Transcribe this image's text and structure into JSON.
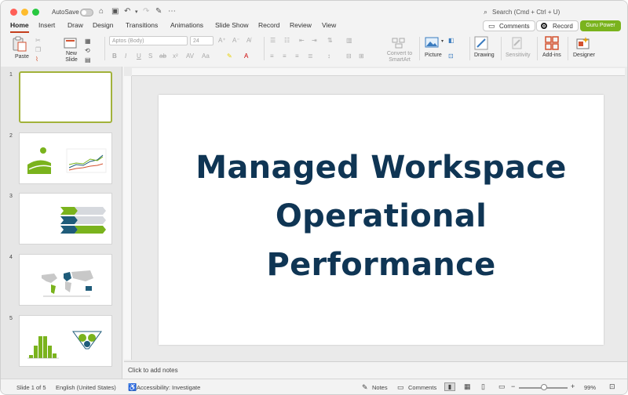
{
  "titlebar": {
    "autosave_label": "AutoSave",
    "search_placeholder": "Search (Cmd + Ctrl + U)"
  },
  "tabs": [
    "Home",
    "Insert",
    "Draw",
    "Design",
    "Transitions",
    "Animations",
    "Slide Show",
    "Record",
    "Review",
    "View"
  ],
  "header_buttons": {
    "comments": "Comments",
    "record": "Record",
    "guru": "Guru Power"
  },
  "ribbon": {
    "paste": "Paste",
    "new_slide": "New Slide",
    "font_name": "Aptos (Body)",
    "font_size": "24",
    "convert_smartart": "Convert to SmartArt",
    "picture": "Picture",
    "drawing": "Drawing",
    "sensitivity": "Sensitivity",
    "addins": "Add-ins",
    "designer": "Designer"
  },
  "slides": [
    {
      "number": "1"
    },
    {
      "number": "2"
    },
    {
      "number": "3"
    },
    {
      "number": "4"
    },
    {
      "number": "5"
    }
  ],
  "slide": {
    "title_lines": [
      "Managed Workspace",
      "Operational",
      "Performance"
    ]
  },
  "notes_placeholder": "Click to add notes",
  "statusbar": {
    "slide_indicator": "Slide 1 of 5",
    "language": "English (United States)",
    "accessibility": "Accessibility: Investigate",
    "notes": "Notes",
    "comments": "Comments",
    "zoom": "99%"
  },
  "colors": {
    "title_navy": "#0f3554",
    "accent_green": "#7ab31d",
    "teal": "#1f5c7a"
  }
}
